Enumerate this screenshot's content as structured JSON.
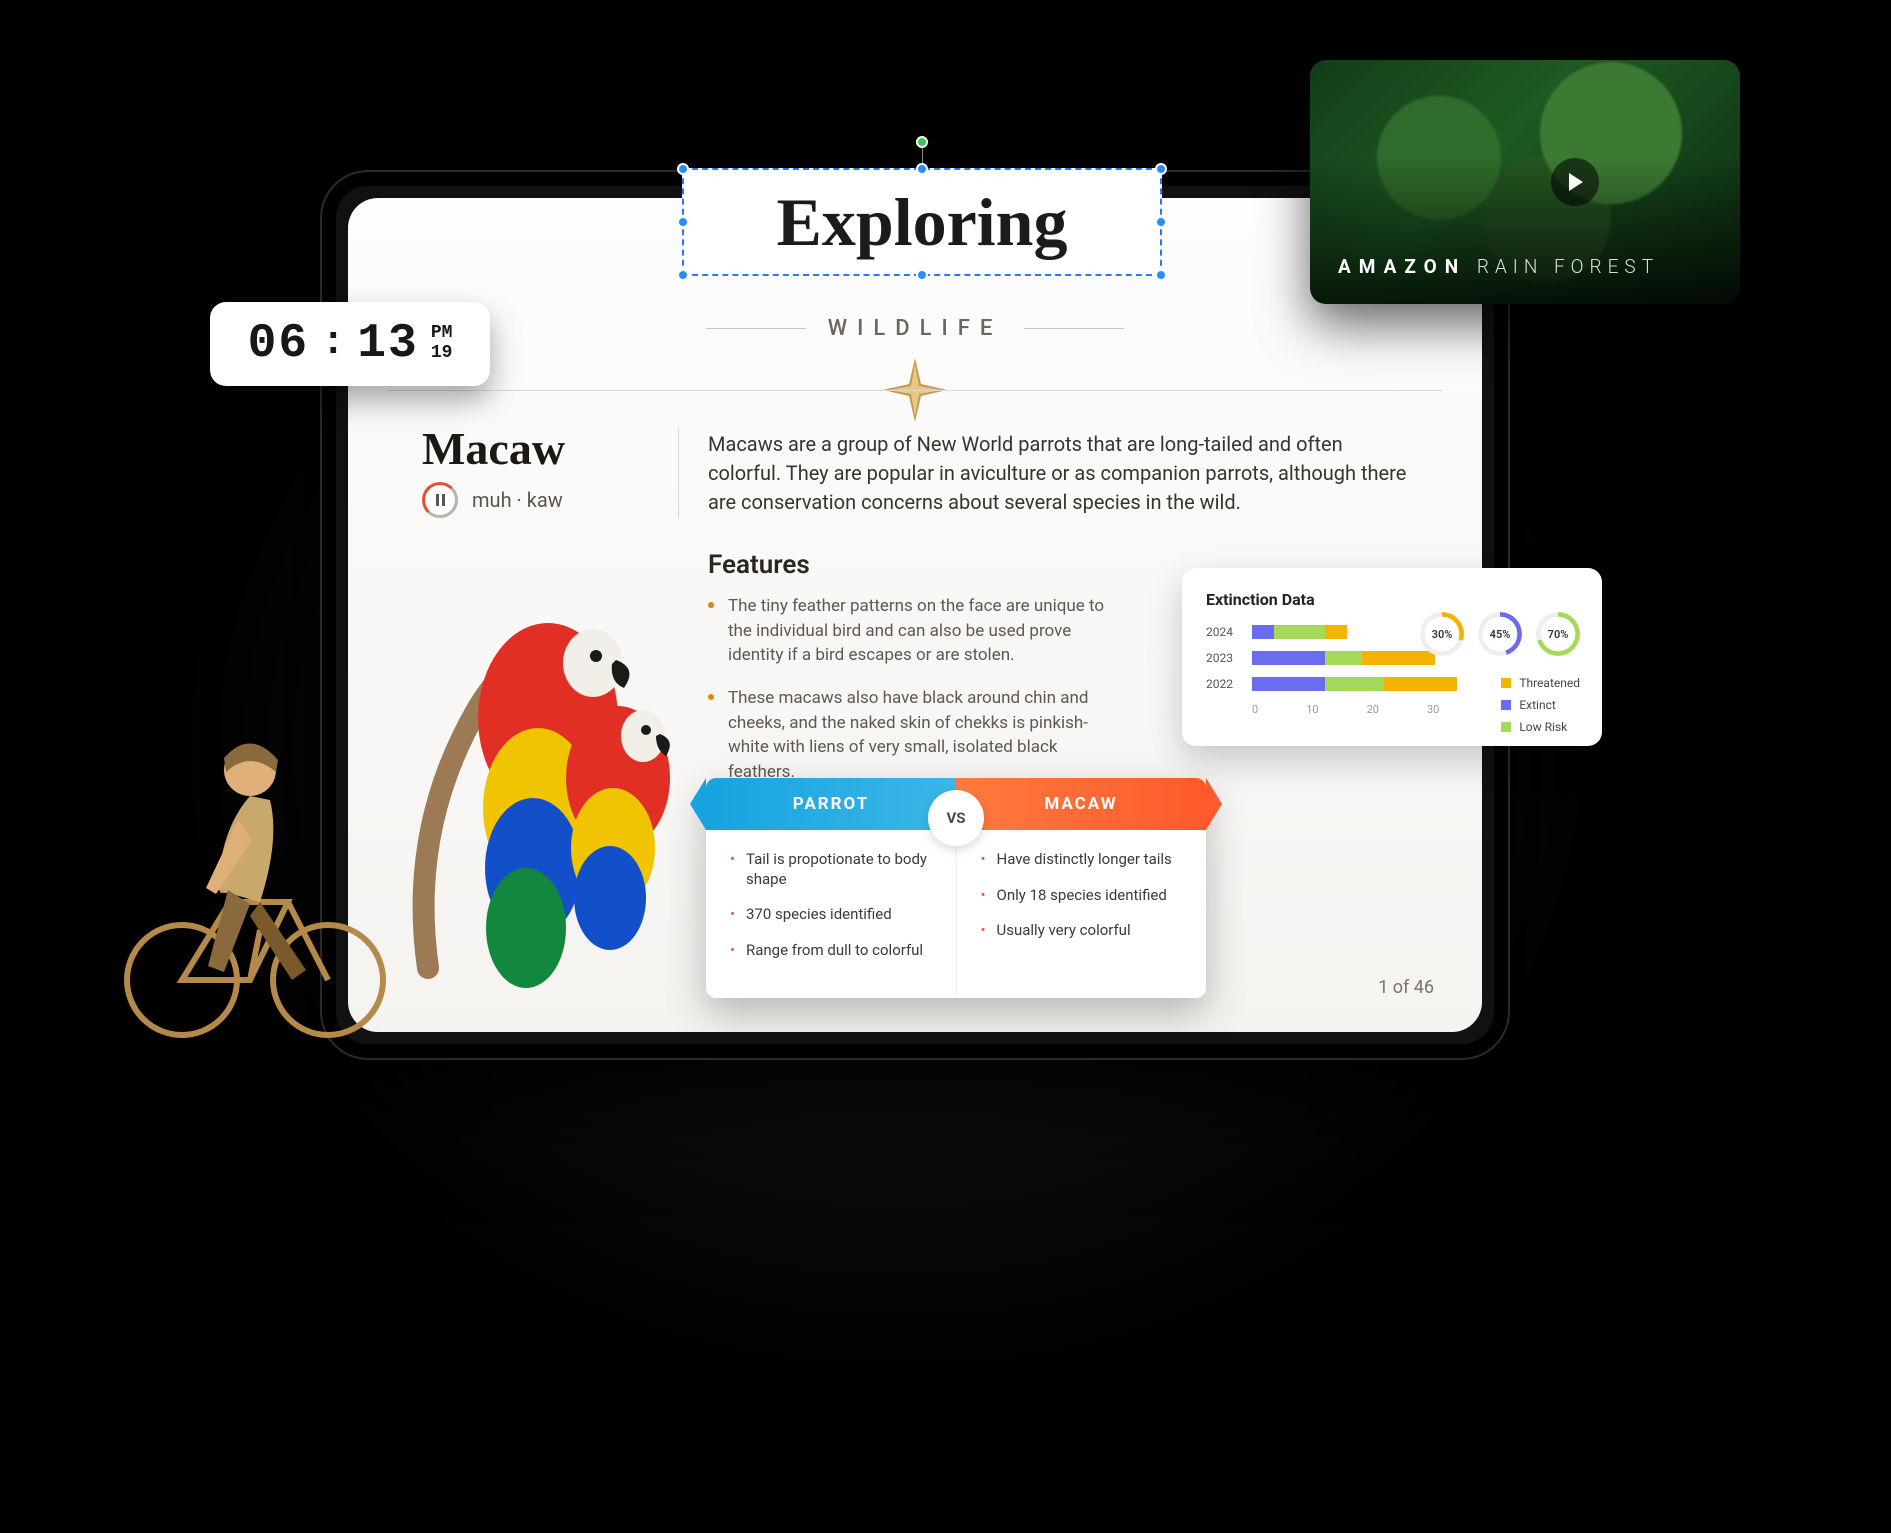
{
  "clock": {
    "hours": "06",
    "minutes": "13",
    "ampm": "PM",
    "day": "19"
  },
  "video": {
    "title_bold": "AMAZON",
    "title_rest": "RAIN FOREST"
  },
  "slide": {
    "title": "Exploring",
    "subtitle": "WILDLIFE",
    "subject": "Macaw",
    "pronunciation": "muh · kaw",
    "intro": "Macaws are a group of New World parrots that are long-tailed and often colorful. They are popular in aviculture or as companion parrots, although there are conservation concerns about several species in the wild.",
    "features_heading": "Features",
    "features": [
      "The tiny feather patterns on the face are unique to the individual bird and can also be used prove identity if a bird escapes or are stolen.",
      "These macaws also have black around chin and cheeks, and the naked skin of chekks is pinkish-white with liens of very small, isolated black feathers."
    ],
    "compare": {
      "left_label": "PARROT",
      "right_label": "MACAW",
      "vs": "VS",
      "left": [
        "Tail is propotionate to body shape",
        "370 species identified",
        "Range from dull to colorful"
      ],
      "right": [
        "Have distinctly longer tails",
        "Only 18 species identified",
        "Usually very colorful"
      ]
    },
    "page_label": "1 of 46"
  },
  "chart_data": {
    "title": "Extinction Data",
    "type": "bar",
    "orientation": "horizontal_stacked",
    "categories": [
      "2024",
      "2023",
      "2022"
    ],
    "xlim": [
      0,
      30
    ],
    "xticks": [
      0,
      10,
      20,
      30
    ],
    "series": [
      {
        "name": "Extinct",
        "color": "#6b6cf0",
        "values": [
          3,
          10,
          10
        ]
      },
      {
        "name": "Low Risk",
        "color": "#a5d95a",
        "values": [
          7,
          5,
          8
        ]
      },
      {
        "name": "Threatened",
        "color": "#f5b301",
        "values": [
          3,
          10,
          10
        ]
      }
    ],
    "legend": [
      "Threatened",
      "Extinct",
      "Low Risk"
    ],
    "donuts": [
      {
        "percent": 30,
        "color": "#f5b301"
      },
      {
        "percent": 45,
        "color": "#6b6cf0"
      },
      {
        "percent": 70,
        "color": "#a5d95a"
      }
    ]
  }
}
